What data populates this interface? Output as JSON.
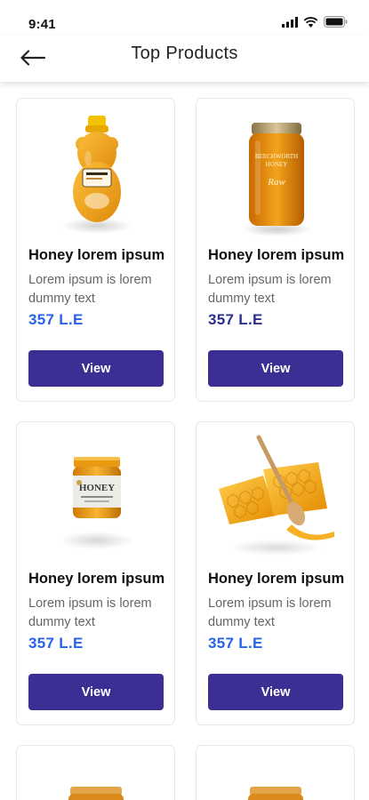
{
  "status_bar": {
    "time": "9:41"
  },
  "header": {
    "title": "Top Products",
    "back_icon": "arrow-left-icon"
  },
  "products": [
    {
      "title": "Honey lorem ipsum",
      "description": "Lorem ipsum is lorem dummy text",
      "price": "357  L.E",
      "button": "View",
      "image": "honey-bear-bottle"
    },
    {
      "title": "Honey lorem ipsum",
      "description": "Lorem ipsum is lorem dummy text",
      "price": "357  L.E",
      "button": "View",
      "image": "honey-jar-tall"
    },
    {
      "title": "Honey lorem ipsum",
      "description": "Lorem ipsum is lorem dummy text",
      "price": "357  L.E",
      "button": "View",
      "image": "honey-jar-labeled"
    },
    {
      "title": "Honey lorem ipsum",
      "description": "Lorem ipsum is lorem dummy text",
      "price": "357  L.E",
      "button": "View",
      "image": "honeycomb-dipper"
    }
  ],
  "colors": {
    "accent": "#3b2f94",
    "price_blue": "#2563eb",
    "price_navy": "#2b2f8f"
  }
}
